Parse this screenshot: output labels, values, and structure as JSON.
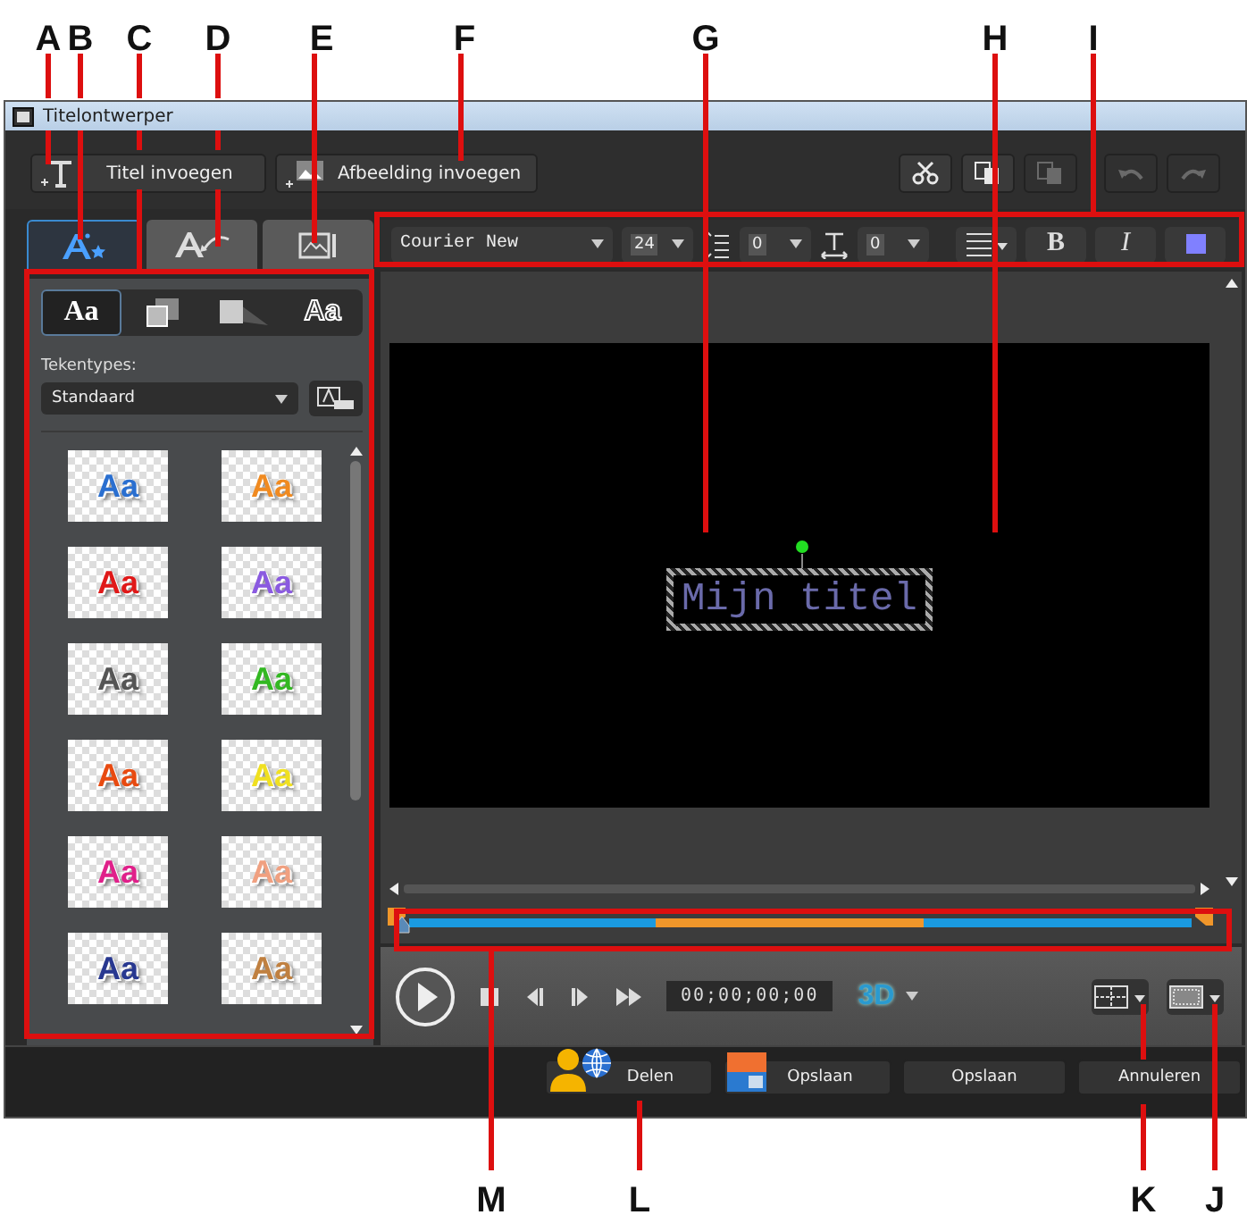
{
  "window": {
    "title": "Titelontwerper"
  },
  "toolbar": {
    "buttons": [
      {
        "label": "Titel invoegen",
        "kind": "title"
      },
      {
        "label": "Afbeelding invoegen",
        "kind": "image"
      }
    ],
    "tools": [
      {
        "kind": "cut",
        "disabled": false
      },
      {
        "kind": "copy",
        "disabled": false
      },
      {
        "kind": "paste",
        "disabled": true
      },
      {
        "kind": "undo",
        "disabled": true
      },
      {
        "kind": "redo",
        "disabled": true
      }
    ]
  },
  "side_tabs": [
    {
      "kind": "style",
      "selected": true
    },
    {
      "kind": "motion",
      "selected": false
    },
    {
      "kind": "background",
      "selected": false
    }
  ],
  "style_tabs": [
    {
      "kind": "text",
      "label": "Aa",
      "selected": true
    },
    {
      "kind": "border",
      "selected": false
    },
    {
      "kind": "shadow",
      "selected": false
    },
    {
      "kind": "outline",
      "label": "Aa",
      "selected": false
    }
  ],
  "font_types": {
    "label": "Tekentypes:",
    "value": "Standaard"
  },
  "presets": [
    {
      "label": "Aa",
      "color": "#2a6fd0"
    },
    {
      "label": "Aa",
      "color": "#f08a20"
    },
    {
      "label": "Aa",
      "color": "#e01818"
    },
    {
      "label": "Aa",
      "color": "#8a5ae0"
    },
    {
      "label": "Aa",
      "color": "#555555"
    },
    {
      "label": "Aa",
      "color": "#33b822"
    },
    {
      "label": "Aa",
      "color": "#e84a10"
    },
    {
      "label": "Aa",
      "color": "#f0e020"
    },
    {
      "label": "Aa",
      "color": "#e0208a"
    },
    {
      "label": "Aa",
      "color": "#f0a080"
    },
    {
      "label": "Aa",
      "color": "#283890"
    },
    {
      "label": "Aa",
      "color": "#c08040"
    }
  ],
  "format_bar": {
    "font": "Courier New",
    "size": "24",
    "line_spacing": "0",
    "char_spacing": "0",
    "bold": "B",
    "italic": "I"
  },
  "canvas": {
    "title_text": "Mijn titel"
  },
  "timeline": {
    "level": 0
  },
  "player": {
    "timecode": "00;00;00;00",
    "mode_3d": "3D"
  },
  "footer": {
    "buttons": [
      {
        "label": "Delen",
        "kind": "share"
      },
      {
        "label": "Opslaan",
        "kind": "save-icon"
      },
      {
        "label": "Opslaan",
        "kind": "plain"
      },
      {
        "label": "Annuleren",
        "kind": "plain"
      }
    ]
  },
  "callouts": [
    {
      "letter": "A"
    },
    {
      "letter": "B"
    },
    {
      "letter": "C"
    },
    {
      "letter": "D"
    },
    {
      "letter": "E"
    },
    {
      "letter": "F"
    },
    {
      "letter": "G"
    },
    {
      "letter": "H"
    },
    {
      "letter": "I"
    },
    {
      "letter": "M"
    },
    {
      "letter": "L"
    },
    {
      "letter": "K"
    },
    {
      "letter": "J"
    }
  ]
}
